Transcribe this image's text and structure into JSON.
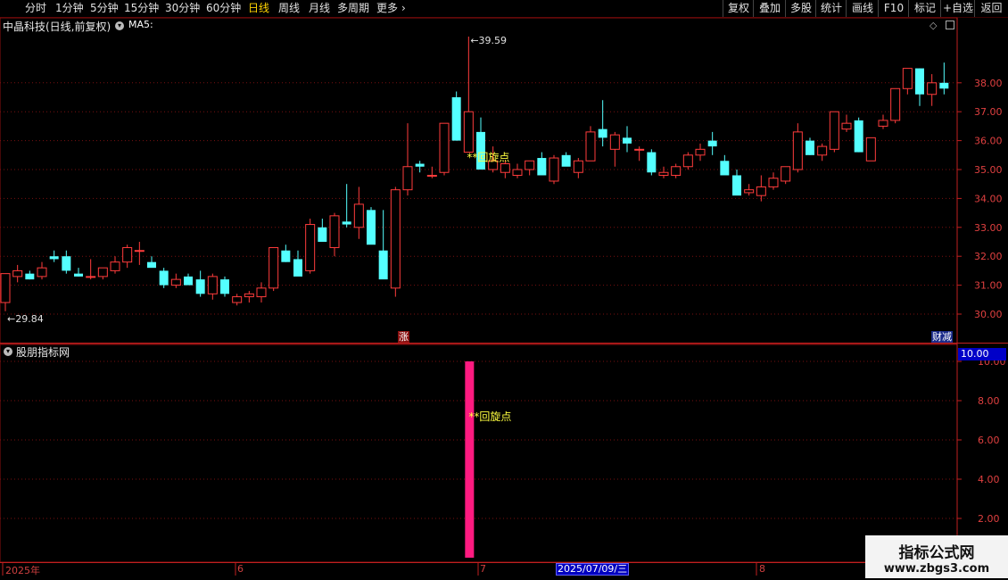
{
  "toolbar": {
    "periods": [
      "分时",
      "1分钟",
      "5分钟",
      "15分钟",
      "30分钟",
      "60分钟",
      "日线",
      "周线",
      "月线",
      "多周期",
      "更多"
    ],
    "active_period": "日线",
    "more_arrow": "›",
    "buttons": [
      "复权",
      "叠加",
      "多股",
      "统计",
      "画线",
      "F10",
      "标记",
      "+自选",
      "返回"
    ]
  },
  "main_chart": {
    "title": "中晶科技(日线,前复权)",
    "indicator_label": "MA5:",
    "icons": [
      "circle-chevron-icon",
      "diamond-icon",
      "panel-toggle-icon"
    ]
  },
  "indicator_panel": {
    "title": "股朋指标网",
    "current_value": "10.00",
    "signal_label": "**回旋点",
    "signal_value": 10.0
  },
  "tags": {
    "zhang": "涨",
    "caijian": "财减"
  },
  "date_axis": {
    "labels": [
      {
        "text": "2025年"
      },
      {
        "text": "6"
      },
      {
        "text": "7"
      },
      {
        "text": "8"
      }
    ],
    "cursor_label": "2025/07/09/三"
  },
  "watermark": {
    "title": "指标公式网",
    "url": "www.zbgs3.com"
  },
  "colors": {
    "up": "#ff3c3c",
    "down": "#54ffff",
    "grid": "#7a1010",
    "signal_bar": "#ff1a80",
    "signal_text": "#ffff40",
    "axis": "#e04040"
  },
  "chart_data": {
    "type": "candlestick",
    "y_ticks": [
      30.0,
      31.0,
      32.0,
      33.0,
      34.0,
      35.0,
      36.0,
      37.0,
      38.0
    ],
    "ylim": [
      29.5,
      39.7
    ],
    "max_label": "39.59",
    "min_label": "29.84",
    "candles": [
      [
        30.4,
        31.4,
        30.1,
        31.4
      ],
      [
        31.3,
        31.7,
        31.1,
        31.5
      ],
      [
        31.4,
        31.5,
        31.2,
        31.2
      ],
      [
        31.3,
        31.8,
        31.2,
        31.6
      ],
      [
        32.0,
        32.2,
        31.8,
        31.9
      ],
      [
        32.0,
        32.2,
        31.4,
        31.5
      ],
      [
        31.4,
        31.6,
        31.3,
        31.3
      ],
      [
        31.3,
        31.9,
        31.2,
        31.3
      ],
      [
        31.3,
        31.6,
        31.2,
        31.6
      ],
      [
        31.5,
        32.0,
        31.4,
        31.8
      ],
      [
        31.8,
        32.4,
        31.6,
        32.3
      ],
      [
        32.2,
        32.5,
        31.7,
        32.2
      ],
      [
        31.8,
        32.0,
        31.7,
        31.6
      ],
      [
        31.5,
        31.6,
        30.9,
        31.0
      ],
      [
        31.0,
        31.4,
        30.9,
        31.2
      ],
      [
        31.3,
        31.4,
        31.1,
        31.0
      ],
      [
        31.2,
        31.5,
        30.6,
        30.7
      ],
      [
        30.7,
        31.4,
        30.5,
        31.3
      ],
      [
        31.2,
        31.3,
        30.6,
        30.7
      ],
      [
        30.4,
        30.7,
        30.3,
        30.6
      ],
      [
        30.6,
        30.8,
        30.4,
        30.7
      ],
      [
        30.6,
        31.1,
        30.4,
        30.9
      ],
      [
        30.9,
        32.1,
        30.8,
        32.3
      ],
      [
        32.2,
        32.4,
        31.8,
        31.8
      ],
      [
        31.9,
        32.2,
        31.5,
        31.3
      ],
      [
        31.5,
        33.3,
        31.4,
        33.1
      ],
      [
        33.0,
        33.3,
        32.8,
        32.5
      ],
      [
        32.3,
        33.5,
        32.0,
        33.4
      ],
      [
        33.2,
        34.5,
        33.0,
        33.1
      ],
      [
        33.0,
        34.4,
        32.6,
        33.8
      ],
      [
        33.6,
        33.7,
        32.5,
        32.4
      ],
      [
        32.2,
        33.6,
        32.0,
        31.2
      ],
      [
        30.9,
        34.4,
        30.6,
        34.3
      ],
      [
        34.3,
        36.6,
        34.1,
        35.1
      ],
      [
        35.2,
        35.3,
        34.9,
        35.1
      ],
      [
        34.8,
        35.1,
        34.7,
        34.8
      ],
      [
        34.9,
        36.5,
        34.8,
        36.6
      ],
      [
        37.5,
        37.7,
        36.0,
        36.0
      ],
      [
        35.6,
        39.6,
        35.6,
        37.0
      ],
      [
        36.3,
        36.8,
        35.2,
        35.0
      ],
      [
        35.0,
        35.8,
        34.9,
        35.3
      ],
      [
        34.9,
        35.3,
        34.7,
        35.2
      ],
      [
        34.8,
        35.2,
        34.7,
        35.0
      ],
      [
        35.0,
        35.3,
        34.8,
        35.3
      ],
      [
        35.4,
        35.6,
        35.1,
        34.8
      ],
      [
        34.6,
        35.5,
        34.5,
        35.4
      ],
      [
        35.5,
        35.6,
        35.2,
        35.1
      ],
      [
        34.9,
        35.4,
        34.7,
        35.3
      ],
      [
        35.3,
        36.5,
        35.3,
        36.3
      ],
      [
        36.4,
        37.4,
        35.8,
        36.1
      ],
      [
        35.7,
        36.3,
        35.1,
        36.2
      ],
      [
        36.1,
        36.5,
        35.6,
        35.9
      ],
      [
        35.7,
        35.8,
        35.3,
        35.7
      ],
      [
        35.6,
        35.7,
        34.8,
        34.9
      ],
      [
        34.8,
        35.1,
        34.7,
        34.9
      ],
      [
        34.8,
        35.2,
        34.7,
        35.1
      ],
      [
        35.1,
        35.6,
        35.0,
        35.5
      ],
      [
        35.5,
        35.9,
        35.3,
        35.7
      ],
      [
        36.0,
        36.3,
        35.5,
        35.8
      ],
      [
        35.3,
        35.5,
        34.9,
        34.8
      ],
      [
        34.8,
        35.0,
        34.2,
        34.1
      ],
      [
        34.2,
        34.5,
        34.1,
        34.3
      ],
      [
        34.1,
        34.8,
        33.9,
        34.4
      ],
      [
        34.4,
        34.9,
        34.3,
        34.7
      ],
      [
        34.6,
        35.1,
        34.5,
        35.1
      ],
      [
        35.0,
        36.6,
        34.9,
        36.3
      ],
      [
        36.0,
        36.1,
        35.5,
        35.5
      ],
      [
        35.5,
        35.9,
        35.3,
        35.8
      ],
      [
        35.7,
        37.0,
        35.6,
        37.0
      ],
      [
        36.4,
        36.9,
        36.3,
        36.6
      ],
      [
        36.7,
        36.8,
        35.6,
        35.6
      ],
      [
        35.3,
        36.1,
        35.3,
        36.1
      ],
      [
        36.5,
        36.9,
        36.4,
        36.7
      ],
      [
        36.7,
        37.8,
        36.6,
        37.8
      ],
      [
        37.8,
        38.4,
        37.6,
        38.5
      ],
      [
        38.5,
        38.5,
        37.2,
        37.6
      ],
      [
        37.6,
        38.3,
        37.2,
        38.0
      ],
      [
        38.0,
        38.7,
        37.6,
        37.8
      ]
    ],
    "signals": [
      {
        "index": 38,
        "text": "**回旋点"
      }
    ],
    "indicator_ticks": [
      2.0,
      4.0,
      6.0,
      8.0,
      10.0
    ],
    "indicator_ylim": [
      0,
      10.4
    ]
  }
}
